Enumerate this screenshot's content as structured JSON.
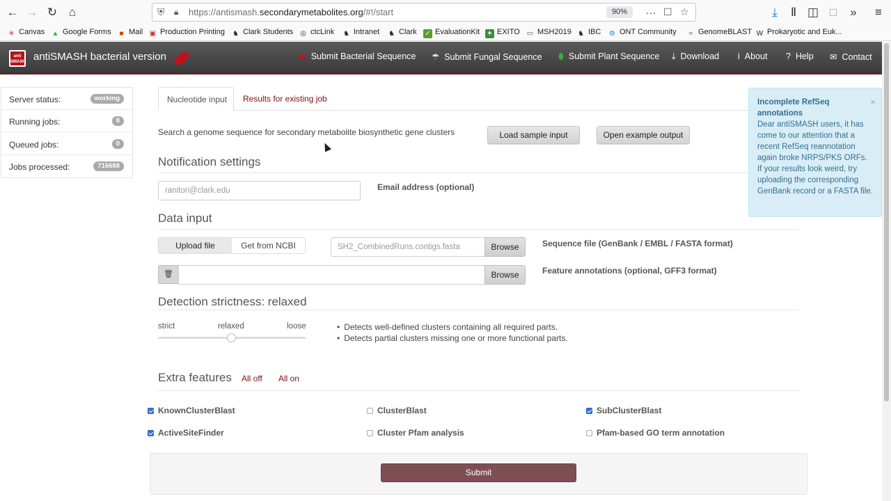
{
  "browser": {
    "url_prefix": "https://antismash.",
    "url_host": "secondarymetabolites.org",
    "url_suffix": "/#!/start",
    "zoom": "90%",
    "bookmarks": [
      "Canvas",
      "Google Forms",
      "Mail",
      "Production Printing",
      "Clark Students",
      "ctcLink",
      "Intranet",
      "Clark",
      "EvaluationKit",
      "EXITO",
      "MSH2019",
      "IBC",
      "ONT Community",
      "GenomeBLAST",
      "Prokaryotic and Euk..."
    ]
  },
  "navbar": {
    "brand": "antiSMASH bacterial version",
    "logo_text": "anti SMASH",
    "items": [
      "Submit Bacterial Sequence",
      "Submit Fungal Sequence",
      "Submit Plant Sequence",
      "Download",
      "About",
      "Help",
      "Contact"
    ]
  },
  "status": {
    "rows": [
      {
        "label": "Server status:",
        "value": "working"
      },
      {
        "label": "Running jobs:",
        "value": "8"
      },
      {
        "label": "Queued jobs:",
        "value": "0"
      },
      {
        "label": "Jobs processed:",
        "value": "716688"
      }
    ]
  },
  "form": {
    "tab_active": "Nucleotide input",
    "tab_other": "Results for existing job",
    "description": "Search a genome sequence for secondary metabolite biosynthetic gene clusters",
    "load_sample": "Load sample input",
    "open_example": "Open example output",
    "notification_title": "Notification settings",
    "email_placeholder": "ranitori@clark.edu",
    "email_label": "Email address (optional)",
    "data_input_title": "Data input",
    "upload_file": "Upload file",
    "get_from_ncbi": "Get from NCBI",
    "sequence_file_value": "SH2_CombinedRuns.contigs.fasta",
    "browse": "Browse",
    "sequence_label": "Sequence file (GenBank / EMBL / FASTA format)",
    "feature_label": "Feature annotations (optional, GFF3 format)",
    "strictness_title": "Detection strictness: relaxed",
    "strictness_levels": [
      "strict",
      "relaxed",
      "loose"
    ],
    "strictness_value": "relaxed",
    "strictness_bullets": [
      "Detects well-defined clusters containing all required parts.",
      "Detects partial clusters missing one or more functional parts."
    ],
    "extra_title": "Extra features",
    "all_off": "All off",
    "all_on": "All on",
    "features": [
      {
        "label": "KnownClusterBlast",
        "checked": true
      },
      {
        "label": "ClusterBlast",
        "checked": false
      },
      {
        "label": "SubClusterBlast",
        "checked": true
      },
      {
        "label": "ActiveSiteFinder",
        "checked": true
      },
      {
        "label": "Cluster Pfam analysis",
        "checked": false
      },
      {
        "label": "Pfam-based GO term annotation",
        "checked": false
      }
    ],
    "submit": "Submit"
  },
  "notice": {
    "title": "Incomplete RefSeq annotations",
    "body": "Dear antiSMASH users, it has come to our attention that a recent RefSeq reannotation again broke NRPS/PKS ORFs. If your results look weird, try uploading the corresponding GenBank record or a FASTA file.",
    "close": "×"
  },
  "colors": {
    "accent": "#810e15",
    "submit": "#7d4f54",
    "notice_bg": "#d9edf7",
    "checkbox_on": "#3572d6"
  }
}
